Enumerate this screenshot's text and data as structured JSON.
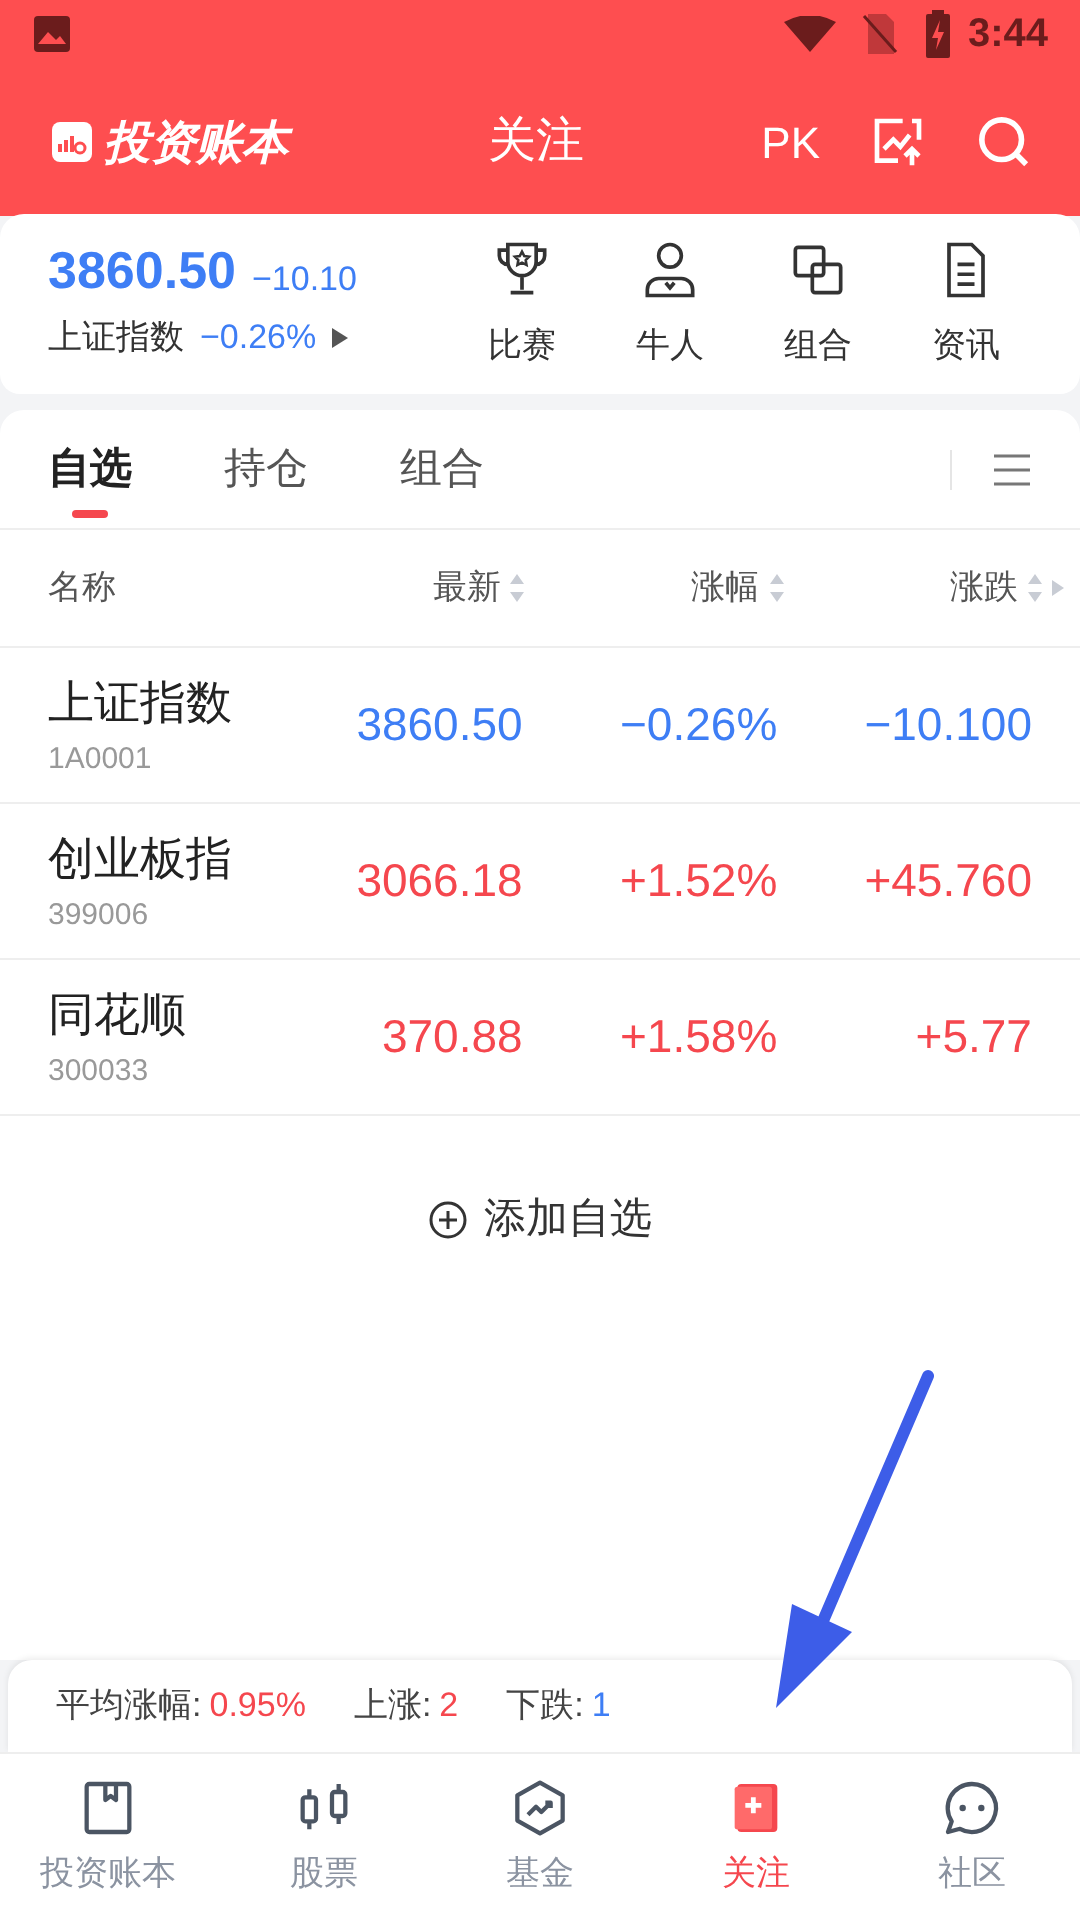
{
  "status_bar": {
    "time": "3:44"
  },
  "header": {
    "logo": "投资账本",
    "title": "关注",
    "pk": "PK"
  },
  "quote": {
    "price": "3860.50",
    "change": "−10.10",
    "name": "上证指数",
    "percent": "−0.26%",
    "color": "#3e7ef5"
  },
  "shortcuts": [
    {
      "kind": "trophy",
      "label": "比赛"
    },
    {
      "kind": "person",
      "label": "牛人"
    },
    {
      "kind": "squares",
      "label": "组合"
    },
    {
      "kind": "doc",
      "label": "资讯"
    }
  ],
  "tabs": [
    {
      "label": "自选",
      "selected": true
    },
    {
      "label": "持仓",
      "selected": false
    },
    {
      "label": "组合",
      "selected": false
    }
  ],
  "table": {
    "columns": [
      "名称",
      "最新",
      "涨幅",
      "涨跌"
    ],
    "rows": [
      {
        "name": "上证指数",
        "code": "1A0001",
        "price": "3860.50",
        "percent": "−0.26%",
        "change": "−10.100",
        "color": "#3e7ef5"
      },
      {
        "name": "创业板指",
        "code": "399006",
        "price": "3066.18",
        "percent": "+1.52%",
        "change": "+45.760",
        "color": "#f5474e"
      },
      {
        "name": "同花顺",
        "code": "300033",
        "price": "370.88",
        "percent": "+1.58%",
        "change": "+5.77",
        "color": "#f5474e"
      }
    ]
  },
  "add_button": "添加自选",
  "summary": [
    {
      "label": "平均涨幅:",
      "value": "0.95%",
      "color": "#f5474e"
    },
    {
      "label": "上涨:",
      "value": "2",
      "color": "#f5474e"
    },
    {
      "label": "下跌:",
      "value": "1",
      "color": "#3e7ef5"
    }
  ],
  "nav": [
    {
      "kind": "book",
      "label": "投资账本",
      "selected": false
    },
    {
      "kind": "candles",
      "label": "股票",
      "selected": false
    },
    {
      "kind": "hexagon",
      "label": "基金",
      "selected": false
    },
    {
      "kind": "bookmark",
      "label": "关注",
      "selected": true
    },
    {
      "kind": "chat",
      "label": "社区",
      "selected": false
    }
  ]
}
